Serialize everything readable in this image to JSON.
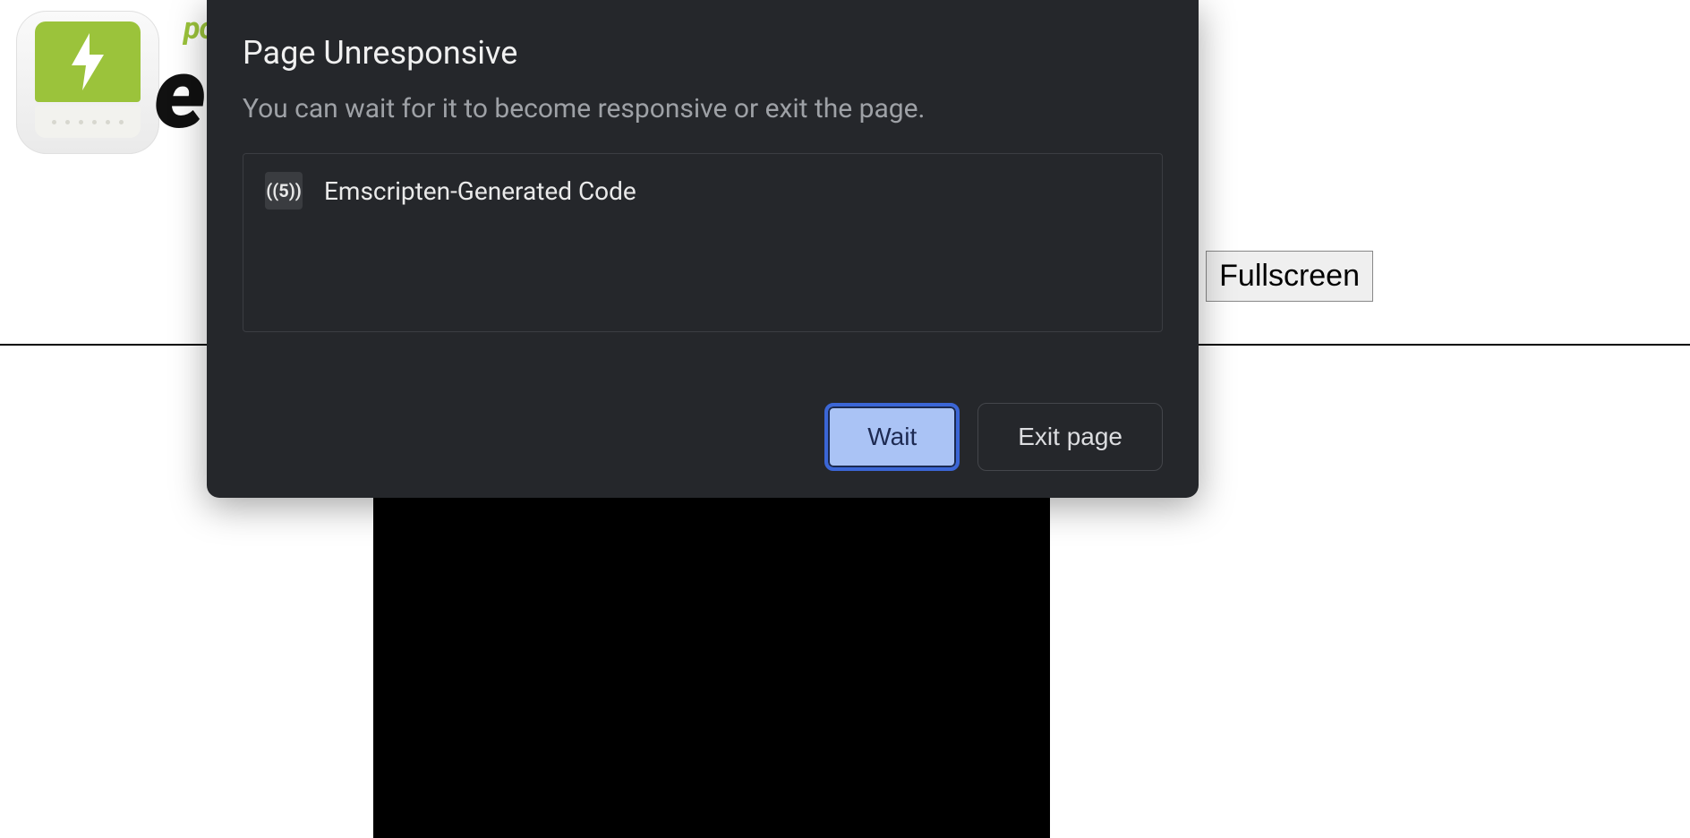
{
  "page": {
    "wordmark_powered": "po",
    "wordmark_em": "e",
    "fullscreen_label": "Fullscreen"
  },
  "dialog": {
    "title": "Page Unresponsive",
    "subtitle": "You can wait for it to become responsive or exit the page.",
    "items": [
      {
        "favicon_text": "((5))",
        "name": "Emscripten-Generated Code"
      }
    ],
    "buttons": {
      "wait": "Wait",
      "exit": "Exit page"
    }
  }
}
